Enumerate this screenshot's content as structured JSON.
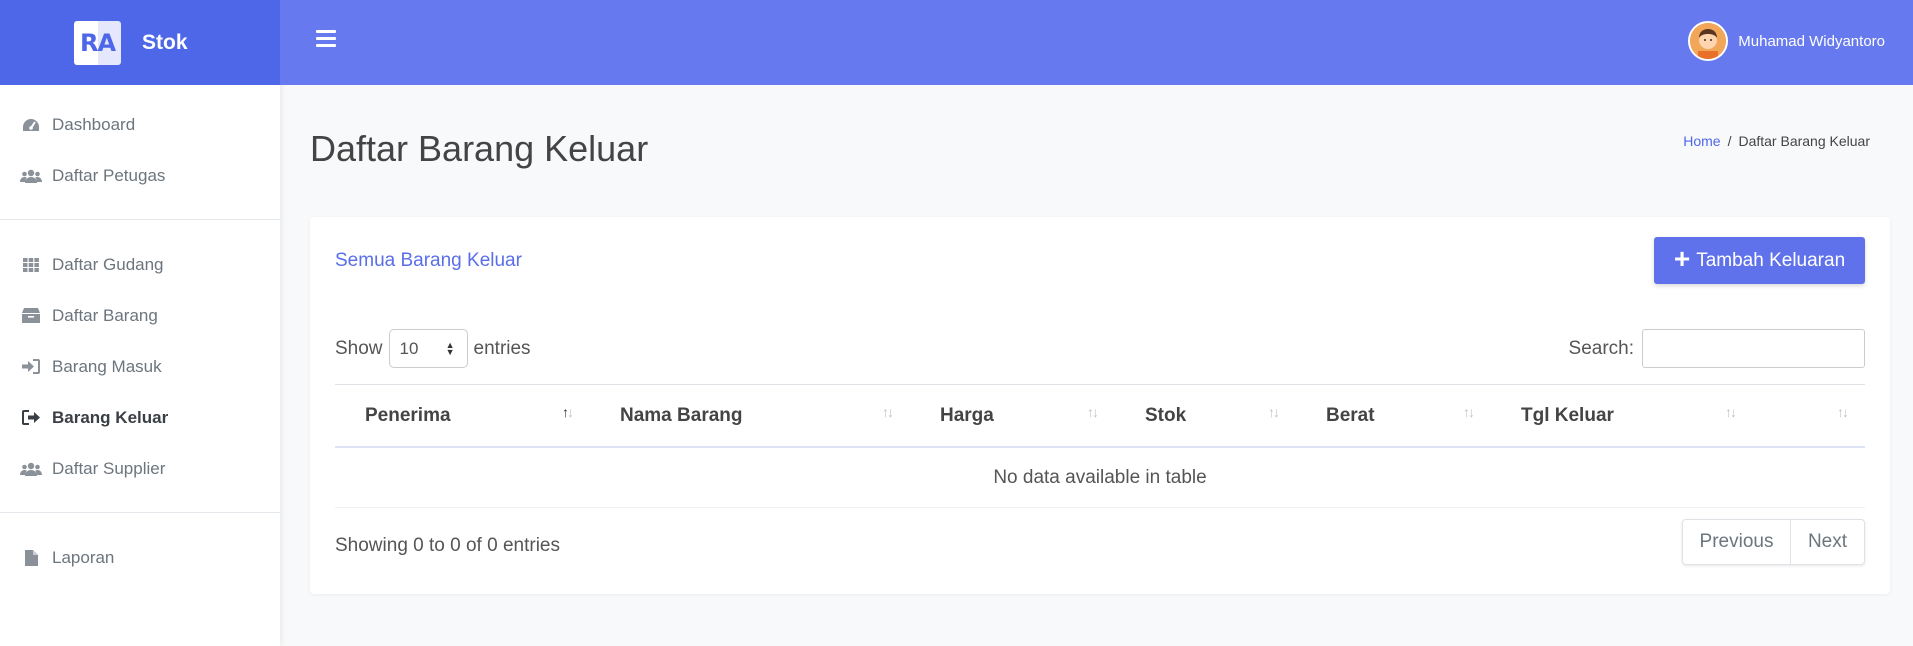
{
  "brand": {
    "logo_text": "RA",
    "name": "Stok"
  },
  "sidebar": {
    "items": [
      {
        "label": "Dashboard",
        "icon": "speedometer-icon"
      },
      {
        "label": "Daftar Petugas",
        "icon": "users-icon"
      },
      {
        "label": "Daftar Gudang",
        "icon": "grid-icon"
      },
      {
        "label": "Daftar Barang",
        "icon": "box-icon"
      },
      {
        "label": "Barang Masuk",
        "icon": "sign-in-icon"
      },
      {
        "label": "Barang Keluar",
        "icon": "sign-out-icon",
        "active": true
      },
      {
        "label": "Daftar Supplier",
        "icon": "users-icon"
      },
      {
        "label": "Laporan",
        "icon": "file-icon"
      }
    ]
  },
  "topbar": {
    "user_name": "Muhamad Widyantoro",
    "menu_icon": "hamburger-icon"
  },
  "page": {
    "title": "Daftar Barang Keluar",
    "breadcrumb": {
      "home": "Home",
      "separator": "/",
      "current": "Daftar Barang Keluar"
    }
  },
  "card": {
    "title": "Semua Barang Keluar",
    "add_button": "Tambah Keluaran",
    "length": {
      "show": "Show",
      "value": "10",
      "entries": "entries"
    },
    "search_label": "Search:",
    "search_value": "",
    "columns": [
      "Penerima",
      "Nama Barang",
      "Harga",
      "Stok",
      "Berat",
      "Tgl Keluar",
      ""
    ],
    "empty_text": "No data available in table",
    "info": "Showing 0 to 0 of 0 entries",
    "pagination": {
      "previous": "Previous",
      "next": "Next"
    }
  },
  "colors": {
    "brand": "#4e67e8",
    "topbar": "#6779ee",
    "button": "#5f72ec"
  }
}
